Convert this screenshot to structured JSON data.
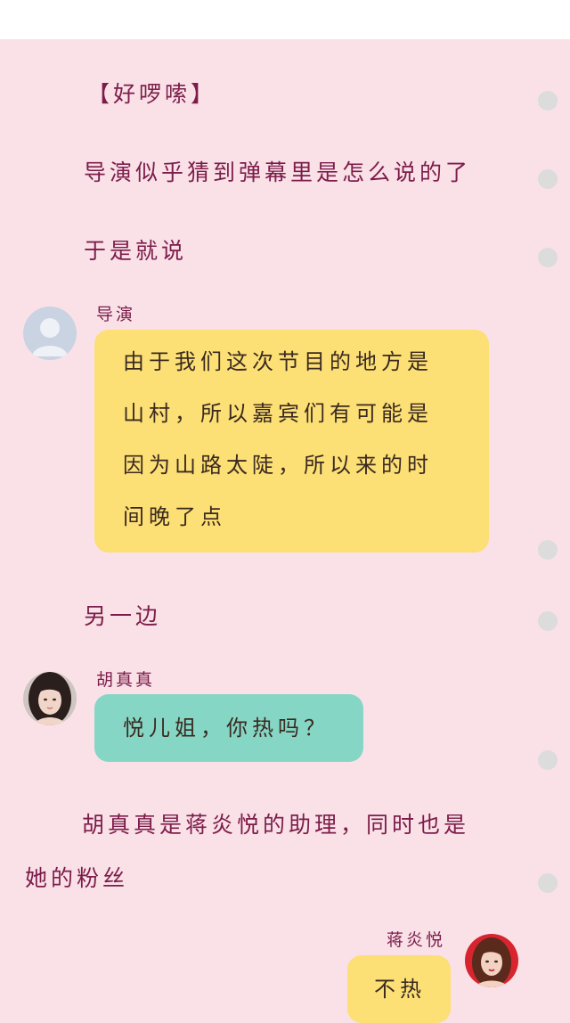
{
  "narration": {
    "line1": "【好啰嗦】",
    "line2": "导演似乎猜到弹幕里是怎么说的了",
    "line3": "于是就说",
    "line4": "另一边",
    "line5a": "胡真真是蒋炎悦的助理，同时也是",
    "line5b": "她的粉丝"
  },
  "messages": [
    {
      "speaker": "导演",
      "lines": [
        "由于我们这次节目的地方是",
        "山村，所以嘉宾们有可能是",
        "因为山路太陡，所以来的时",
        "间晚了点"
      ],
      "bubble_color": "#fcdf75"
    },
    {
      "speaker": "胡真真",
      "text": "悦儿姐，你热吗？",
      "bubble_color": "#86d6c6"
    },
    {
      "speaker": "蒋炎悦",
      "text": "不热",
      "bubble_color": "#fcdf75"
    }
  ],
  "colors": {
    "background": "#f9e1e7",
    "narration_text": "#7d1c4a",
    "binder_hole": "#dcdcdc"
  },
  "icons": {
    "default_avatar": "person-silhouette-icon"
  }
}
